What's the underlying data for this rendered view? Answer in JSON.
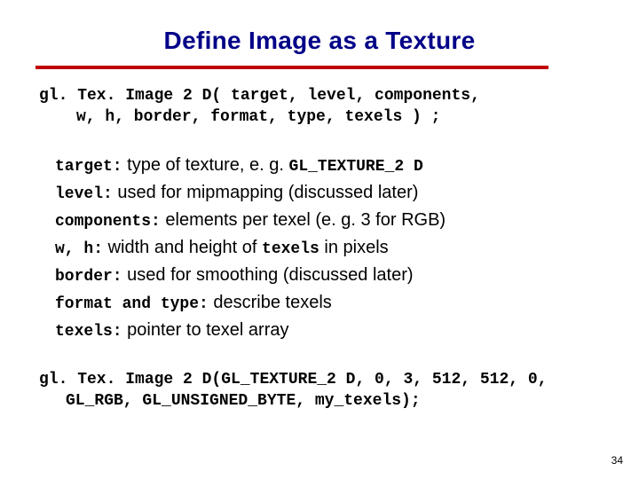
{
  "title": "Define Image as a Texture",
  "signature": {
    "line1": "gl. Tex. Image 2 D( target, level, components,",
    "line2": "w, h, border, format, type, texels ) ;"
  },
  "defs": {
    "target": {
      "term": "target:",
      "desc_a": " type of texture, e. g. ",
      "code": "GL_TEXTURE_2 D"
    },
    "level": {
      "term": "level:",
      "desc": " used for mipmapping (discussed later)"
    },
    "components": {
      "term": "components:",
      "desc": " elements per texel (e. g. 3 for RGB)"
    },
    "wh": {
      "term": "w, h:",
      "desc_a": " width and height of ",
      "code": "texels",
      "desc_b": " in pixels"
    },
    "border": {
      "term": "border:",
      "desc": " used for smoothing (discussed later)"
    },
    "ftype": {
      "term": "format and type:",
      "desc": " describe texels"
    },
    "texels": {
      "term": "texels:",
      "desc": " pointer to texel array"
    }
  },
  "example": {
    "line1": "gl. Tex. Image 2 D(GL_TEXTURE_2 D, 0, 3, 512, 512, 0,",
    "line2": "GL_RGB, GL_UNSIGNED_BYTE, my_texels);"
  },
  "page": "34"
}
